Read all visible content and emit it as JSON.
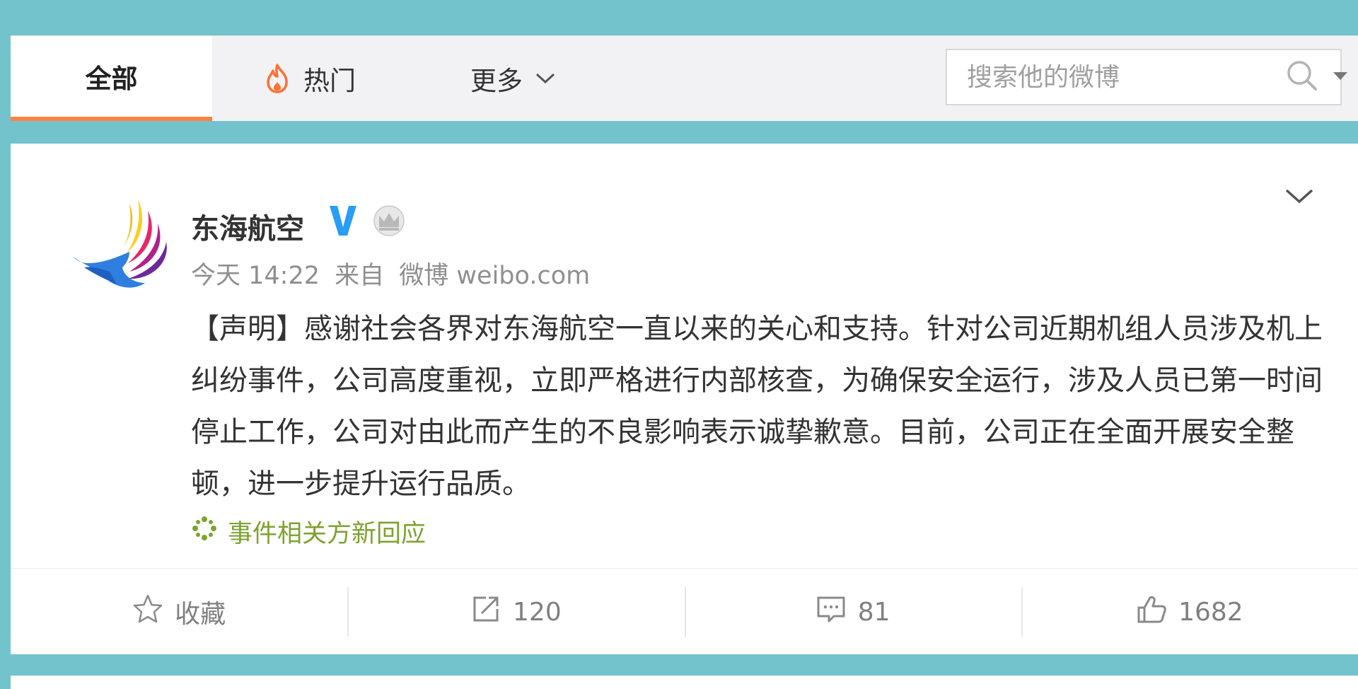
{
  "tabs": {
    "all_label": "全部",
    "hot_label": "热门",
    "more_label": "更多"
  },
  "search": {
    "placeholder": "搜索他的微博"
  },
  "post": {
    "author": "东海航空",
    "time": "今天 14:22",
    "source_prefix": "来自",
    "source": "微博 weibo.com",
    "content": "【声明】感谢社会各界对东海航空一直以来的关心和支持。针对公司近期机组人员涉及机上纠纷事件，公司高度重视，立即严格进行内部核查，为确保安全运行，涉及人员已第一时间停止工作，公司对由此而产生的不良影响表示诚挚歉意。目前，公司正在全面开展安全整顿，进一步提升运行品质。",
    "related_link": "事件相关方新回应"
  },
  "actions": {
    "favorite_label": "收藏",
    "repost_count": "120",
    "comment_count": "81",
    "like_count": "1682"
  },
  "colors": {
    "background": "#72c3cb",
    "active_tab_underline": "#ff8140",
    "verified_blue": "#2a9df4",
    "related_link": "#7ea22f"
  },
  "icons": [
    "fire-icon",
    "chevron-down-icon",
    "search-icon",
    "caret-down-icon",
    "verified-icon",
    "crown-icon",
    "sparkle-icon",
    "star-icon",
    "repost-icon",
    "comment-icon",
    "like-icon"
  ]
}
